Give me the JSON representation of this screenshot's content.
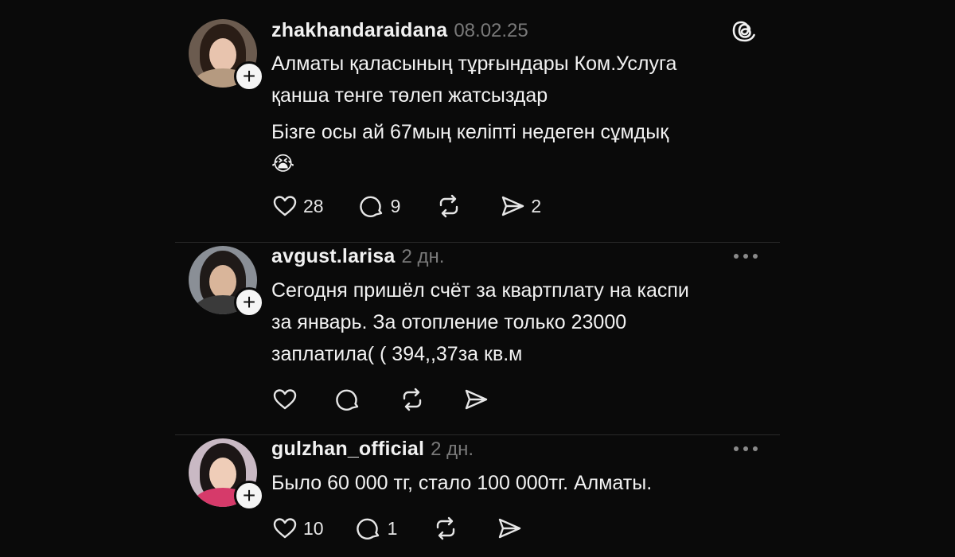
{
  "posts": [
    {
      "username": "zhakhandaraidana",
      "time": "08.02.25",
      "text": [
        "Алматы қаласының тұрғындары Ком.Услуга",
        "қанша тенге төлеп жатсыздар"
      ],
      "text2": [
        "Бізге осы ай 67мың келіпті недеген сұмдық",
        "😭"
      ],
      "likes": "28",
      "replies": "9",
      "reposts": "",
      "shares": "2"
    },
    {
      "username": "avgust.larisa",
      "time": "2 дн.",
      "text": [
        "Сегодня пришёл счёт за квартплату на каспи",
        "за январь.  За отопление только 23000",
        "заплатила( ( 394,,37за кв.м"
      ],
      "likes": "",
      "replies": "",
      "reposts": "",
      "shares": ""
    },
    {
      "username": "gulzhan_official",
      "time": "2 дн.",
      "text": [
        "Было 60 000 тг, стало 100 000тг. Алматы."
      ],
      "likes": "10",
      "replies": "1",
      "reposts": "",
      "shares": ""
    }
  ],
  "follow_symbol": "+",
  "colors": {
    "background": "#0a0a0a",
    "text": "#f2f2f2",
    "muted": "#7a7a7a",
    "divider": "#2a2a2a"
  }
}
